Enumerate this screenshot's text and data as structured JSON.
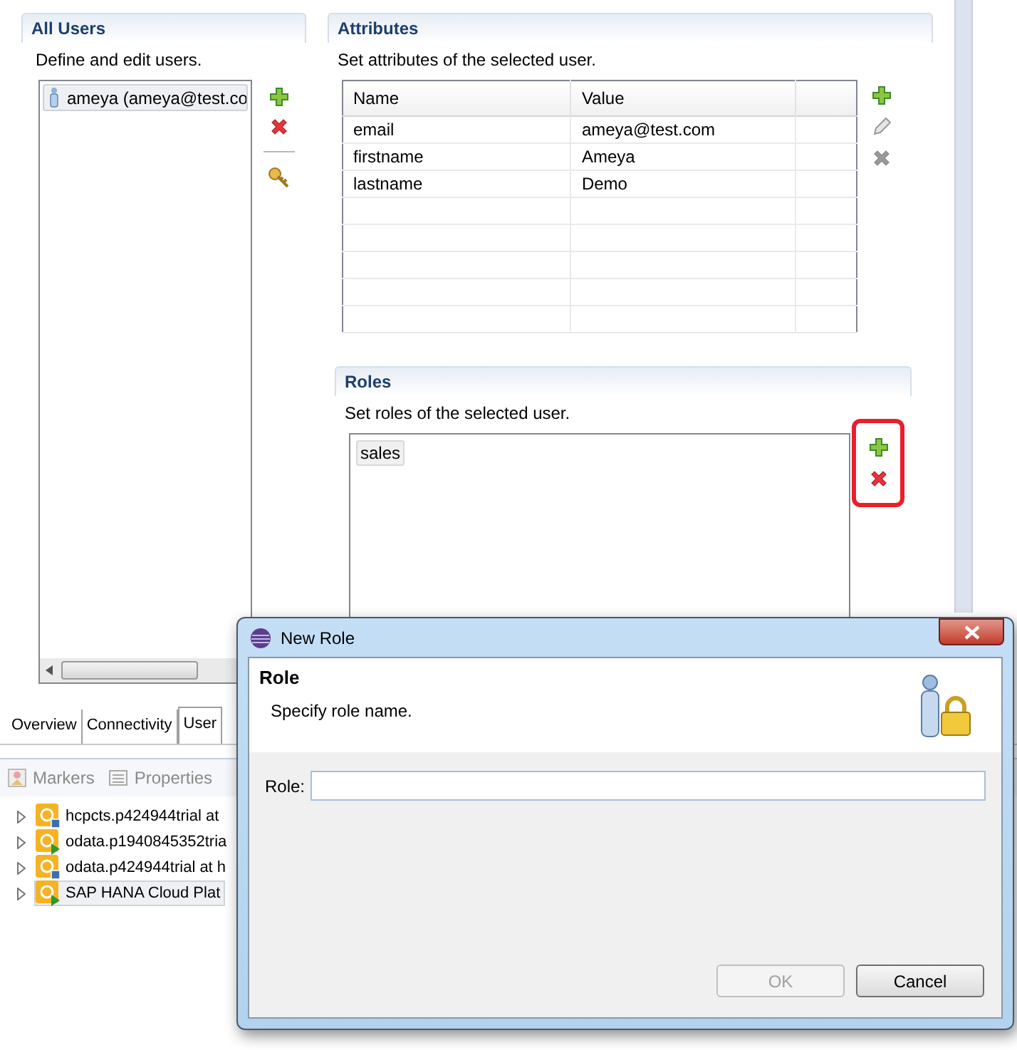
{
  "users_section": {
    "title": "All Users",
    "description": "Define and edit users.",
    "users": [
      {
        "label": "ameya (ameya@test.co",
        "selected": true
      }
    ]
  },
  "attributes_section": {
    "title": "Attributes",
    "description": "Set attributes of the selected user.",
    "columns": [
      "Name",
      "Value"
    ],
    "rows": [
      {
        "name": "email",
        "value": "ameya@test.com"
      },
      {
        "name": "firstname",
        "value": "Ameya"
      },
      {
        "name": "lastname",
        "value": "Demo"
      }
    ],
    "actions": [
      {
        "kind": "add",
        "disabled": false
      },
      {
        "kind": "edit",
        "disabled": true
      },
      {
        "kind": "remove",
        "disabled": true
      }
    ]
  },
  "roles_section": {
    "title": "Roles",
    "description": "Set roles of the selected user.",
    "highlighted": true,
    "roles": [
      {
        "label": "sales"
      }
    ]
  },
  "editor_tabs": [
    {
      "label": "Overview",
      "selected": false
    },
    {
      "label": "Connectivity",
      "selected": false
    },
    {
      "label": "User",
      "selected": true
    }
  ],
  "view_tabs": [
    {
      "label": "Markers",
      "kind": "markers"
    },
    {
      "label": "Properties",
      "kind": "properties"
    }
  ],
  "servers": [
    {
      "label": "hcpcts.p424944trial at",
      "kind": "stopped",
      "selected": false
    },
    {
      "label": "odata.p1940845352tria",
      "kind": "started",
      "selected": false
    },
    {
      "label": "odata.p424944trial at h",
      "kind": "stopped",
      "selected": false
    },
    {
      "label": "SAP HANA Cloud Plat",
      "kind": "started",
      "selected": true
    }
  ],
  "dialog": {
    "title": "New Role",
    "heading": "Role",
    "message": "Specify role name.",
    "field_label": "Role:",
    "ok": {
      "label": "OK",
      "disabled": true
    },
    "cancel": {
      "label": "Cancel",
      "disabled": false
    }
  }
}
